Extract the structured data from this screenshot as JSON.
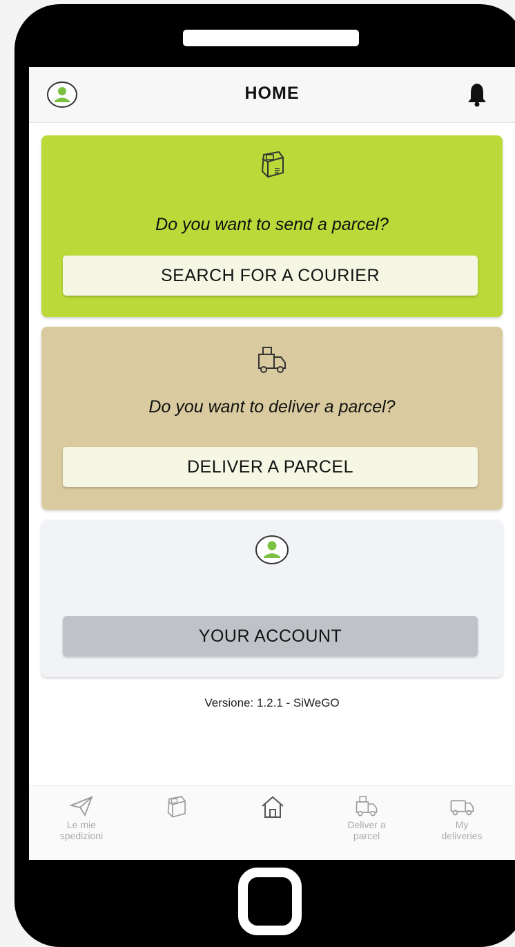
{
  "header": {
    "title": "HOME",
    "avatar_icon": "user-avatar-icon",
    "bell_icon": "bell-icon"
  },
  "cards": {
    "send": {
      "question": "Do you want to send a parcel?",
      "button_label": "SEARCH FOR A COURIER",
      "icon": "package-icon",
      "color": "#bbd939"
    },
    "deliver": {
      "question": "Do you want to deliver a parcel?",
      "button_label": "DELIVER A PARCEL",
      "icon": "delivery-truck-icon",
      "color": "#d9cb9f"
    },
    "account": {
      "button_label": "YOUR ACCOUNT",
      "icon": "user-avatar-icon",
      "color": "#f1f3f7"
    }
  },
  "version": "Versione: 1.2.1 - SiWeGO",
  "tabbar": {
    "tabs": [
      {
        "line1": "Le mie",
        "line2": "spedizioni",
        "icon": "paper-plane-icon"
      },
      {
        "line1": "",
        "line2": "",
        "icon": "package-icon"
      },
      {
        "line1": "",
        "line2": "",
        "icon": "home-icon"
      },
      {
        "line1": "Deliver a",
        "line2": "parcel",
        "icon": "delivery-truck-icon"
      },
      {
        "line1": "My",
        "line2": "deliveries",
        "icon": "van-icon"
      }
    ]
  },
  "colors": {
    "accent_green": "#7cc142",
    "send_card": "#bbd939",
    "deliver_card": "#d9cb9f",
    "account_button": "#bfc3c7"
  }
}
